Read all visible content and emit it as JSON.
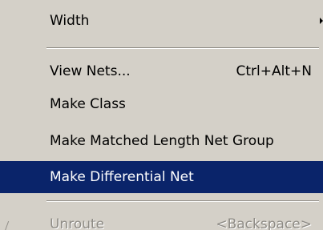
{
  "menu": {
    "width": {
      "label": "Width"
    },
    "view_nets": {
      "label": "View Nets...",
      "shortcut": "Ctrl+Alt+N"
    },
    "make_class": {
      "label": "Make Class"
    },
    "make_matched_length": {
      "label": "Make Matched Length Net Group"
    },
    "make_differential_net": {
      "label": "Make Differential Net"
    },
    "unroute": {
      "label": "Unroute",
      "shortcut": "<Backspace>"
    }
  },
  "colors": {
    "menu_bg": "#d4d0c8",
    "highlight_bg": "#0a246a",
    "highlight_text": "#ffffff",
    "disabled_text": "#8e8b85"
  },
  "icons": {
    "submenu_arrow": "triangle-right-icon",
    "unroute": "unroute-icon"
  }
}
